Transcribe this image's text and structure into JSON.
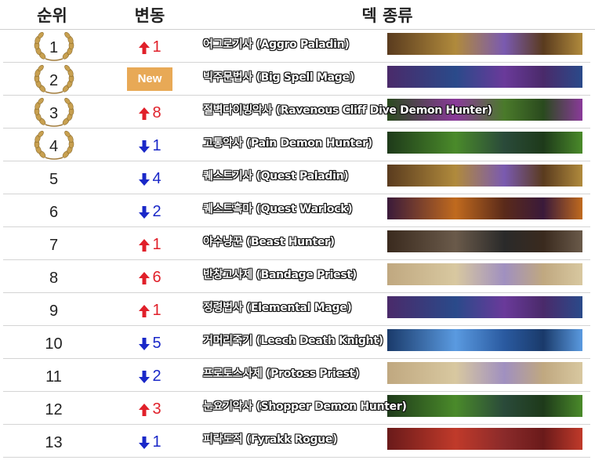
{
  "header": {
    "rank": "순위",
    "change": "변동",
    "deck": "덱 종류"
  },
  "rows": [
    {
      "rank": "1",
      "laurel": true,
      "change_dir": "up",
      "change": "1",
      "deck": "어그로기사 (Aggro Paladin)",
      "colors": [
        "#5a3b1e",
        "#b08a3c",
        "#7a5ab0"
      ]
    },
    {
      "rank": "2",
      "laurel": true,
      "change_dir": "new",
      "change": "New",
      "deck": "빅주문법사 (Big Spell Mage)",
      "colors": [
        "#4a2a6a",
        "#2a4a8a",
        "#6a3a9a"
      ]
    },
    {
      "rank": "3",
      "laurel": true,
      "change_dir": "up",
      "change": "8",
      "deck": "절벽다이빙악사 (Ravenous Cliff Dive Demon Hunter)",
      "colors": [
        "#2a4a1e",
        "#8a3a9a",
        "#4a7a2a"
      ]
    },
    {
      "rank": "4",
      "laurel": true,
      "change_dir": "down",
      "change": "1",
      "deck": "고통악사 (Pain Demon Hunter)",
      "colors": [
        "#1e3a1a",
        "#4a8a2a",
        "#2a4a3a"
      ]
    },
    {
      "rank": "5",
      "laurel": false,
      "change_dir": "down",
      "change": "4",
      "deck": "퀘스트기사 (Quest Paladin)",
      "colors": [
        "#5a3b1e",
        "#b08a3c",
        "#7a5ab0"
      ]
    },
    {
      "rank": "6",
      "laurel": false,
      "change_dir": "down",
      "change": "2",
      "deck": "퀘스트흑마 (Quest Warlock)",
      "colors": [
        "#3a1a3a",
        "#c06a1e",
        "#5a2a1a"
      ]
    },
    {
      "rank": "7",
      "laurel": false,
      "change_dir": "up",
      "change": "1",
      "deck": "야수냥꾼 (Beast Hunter)",
      "colors": [
        "#3a2a1e",
        "#6a5a4a",
        "#2a2a2a"
      ]
    },
    {
      "rank": "8",
      "laurel": false,
      "change_dir": "up",
      "change": "6",
      "deck": "반창고사제 (Bandage Priest)",
      "colors": [
        "#c0a880",
        "#d8c8a0",
        "#a090c0"
      ]
    },
    {
      "rank": "9",
      "laurel": false,
      "change_dir": "up",
      "change": "1",
      "deck": "정령법사 (Elemental Mage)",
      "colors": [
        "#4a2a6a",
        "#2a4a8a",
        "#6a3a9a"
      ]
    },
    {
      "rank": "10",
      "laurel": false,
      "change_dir": "down",
      "change": "5",
      "deck": "거머리죽기 (Leech Death Knight)",
      "colors": [
        "#1a3a6a",
        "#5a9ae0",
        "#2a5aa0"
      ]
    },
    {
      "rank": "11",
      "laurel": false,
      "change_dir": "down",
      "change": "2",
      "deck": "프로토스사제 (Protoss Priest)",
      "colors": [
        "#c0a880",
        "#d8c8a0",
        "#a090c0"
      ]
    },
    {
      "rank": "12",
      "laurel": false,
      "change_dir": "up",
      "change": "3",
      "deck": "눈요기악사 (Shopper Demon Hunter)",
      "colors": [
        "#1e3a1a",
        "#4a8a2a",
        "#2a4a3a"
      ]
    },
    {
      "rank": "13",
      "laurel": false,
      "change_dir": "down",
      "change": "1",
      "deck": "피락도적 (Fyrakk Rogue)",
      "colors": [
        "#6a1a1a",
        "#c03a2a",
        "#8a2a2a"
      ]
    }
  ],
  "colors": {
    "up": "#e0202a",
    "down": "#1a28c8",
    "new_badge": "#e8a956",
    "laurel": "#c8a050"
  }
}
